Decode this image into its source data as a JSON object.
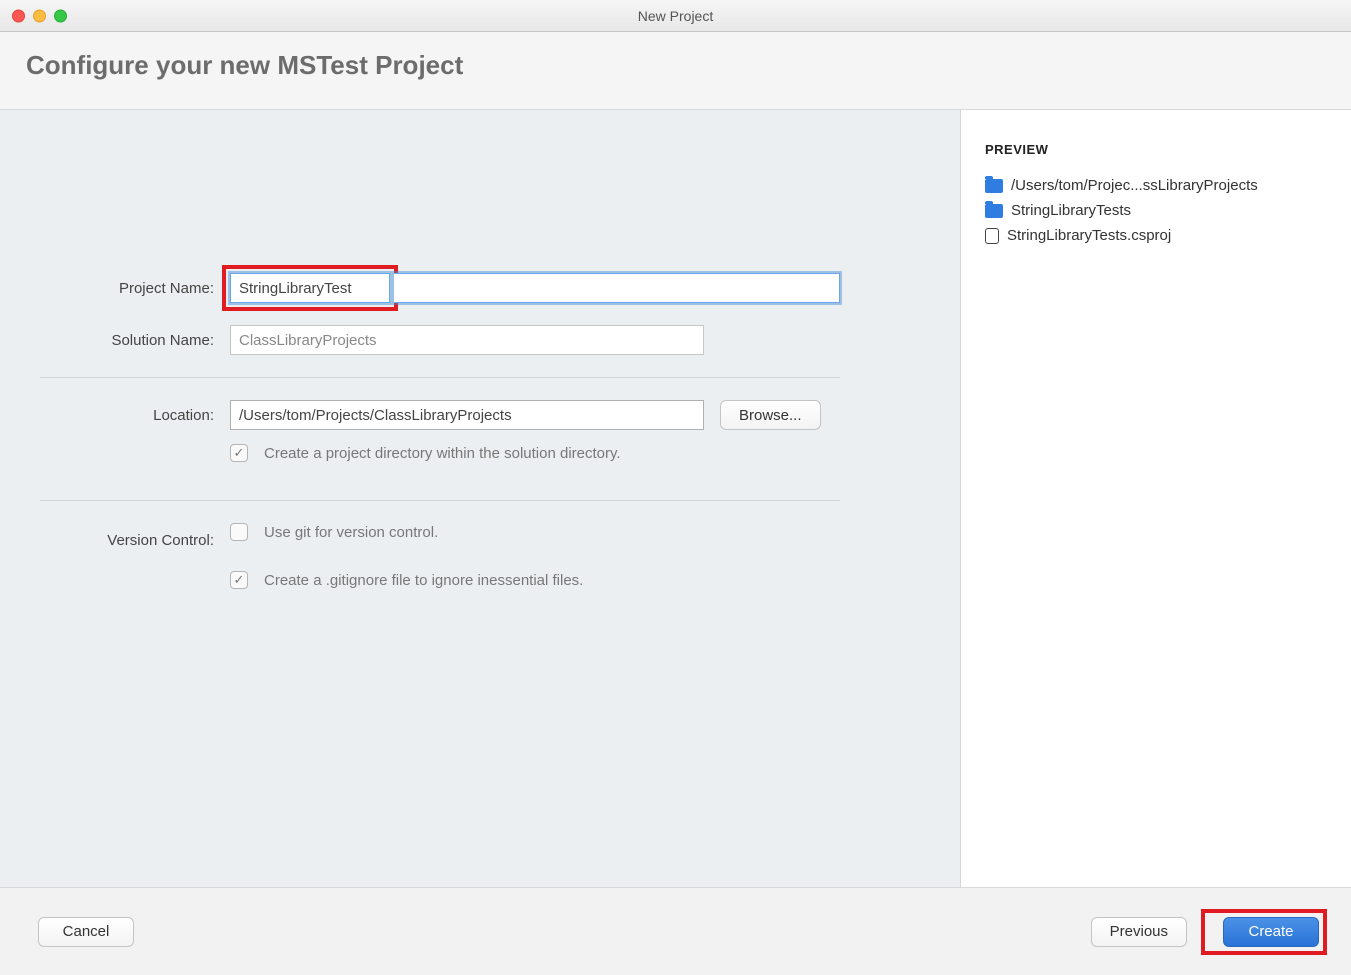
{
  "window": {
    "title": "New Project"
  },
  "header": {
    "title": "Configure your new MSTest Project"
  },
  "form": {
    "project_name": {
      "label": "Project Name:",
      "value": "StringLibraryTest"
    },
    "solution_name": {
      "label": "Solution Name:",
      "value": "ClassLibraryProjects"
    },
    "location": {
      "label": "Location:",
      "value": "/Users/tom/Projects/ClassLibraryProjects",
      "browse_label": "Browse..."
    },
    "create_dir": {
      "checked": true,
      "label": "Create a project directory within the solution directory."
    },
    "version_control": {
      "label": "Version Control:",
      "use_git": {
        "checked": false,
        "label": "Use git for version control."
      },
      "gitignore": {
        "checked": true,
        "label": "Create a .gitignore file to ignore inessential files."
      }
    }
  },
  "preview": {
    "heading": "PREVIEW",
    "root": "/Users/tom/Projec...ssLibraryProjects",
    "folder": "StringLibraryTests",
    "file": "StringLibraryTests.csproj"
  },
  "footer": {
    "cancel": "Cancel",
    "previous": "Previous",
    "create": "Create"
  }
}
